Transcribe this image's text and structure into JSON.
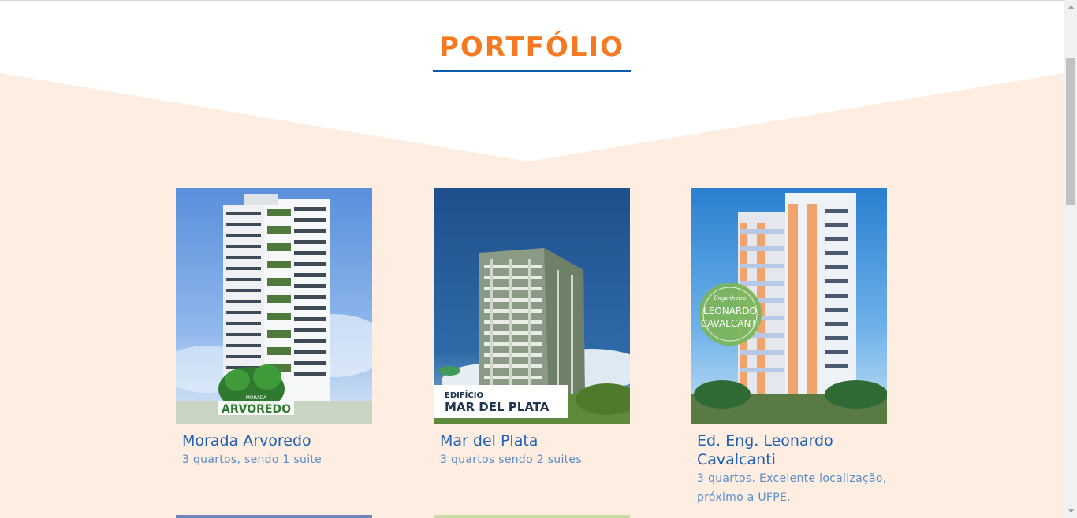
{
  "section": {
    "title": "PORTFÓLIO"
  },
  "colors": {
    "accent": "#f47920",
    "brand_blue": "#0f5bab",
    "band_background": "#fdeee1",
    "title_text": "#1f5fb4",
    "desc_text": "#5b8cc9"
  },
  "portfolio": [
    {
      "title": "Morada Arvoredo",
      "description": "3 quartos, sendo 1 suite",
      "image_logo_line1": "MORADA",
      "image_logo_line2": "ARVOREDO"
    },
    {
      "title": "Mar del Plata",
      "description": "3 quartos sendo 2 suites",
      "image_logo_line1": "EDIFÍCIO",
      "image_logo_line2": "MAR DEL PLATA"
    },
    {
      "title": "Ed. Eng. Leonardo Cavalcanti",
      "description": "3 quartos. Excelente localização, próximo a UFPE.",
      "image_logo_line1": "Engenheiro",
      "image_logo_line2": "LEONARDO",
      "image_logo_line3": "CAVALCANTI"
    }
  ],
  "scrollbar": {
    "up_icon": "triangle-up-icon",
    "down_icon": "triangle-down-icon"
  }
}
